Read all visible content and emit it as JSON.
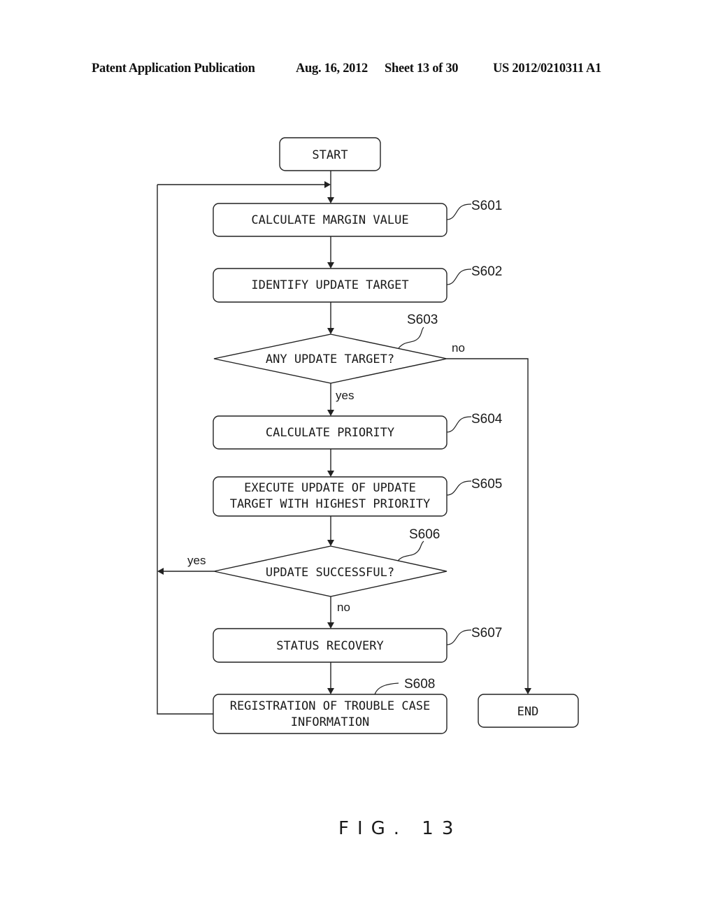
{
  "header": {
    "publication": "Patent Application Publication",
    "date": "Aug. 16, 2012",
    "sheet": "Sheet 13 of 30",
    "number": "US 2012/0210311 A1"
  },
  "flowchart": {
    "start": "START",
    "end": "END",
    "steps": [
      {
        "id": "S601",
        "type": "process",
        "lines": [
          "CALCULATE MARGIN VALUE"
        ]
      },
      {
        "id": "S602",
        "type": "process",
        "lines": [
          "IDENTIFY UPDATE TARGET"
        ]
      },
      {
        "id": "S603",
        "type": "decision",
        "lines": [
          "ANY UPDATE TARGET?"
        ],
        "yes": "S604",
        "no": "END"
      },
      {
        "id": "S604",
        "type": "process",
        "lines": [
          "CALCULATE PRIORITY"
        ]
      },
      {
        "id": "S605",
        "type": "process",
        "lines": [
          "EXECUTE UPDATE OF UPDATE",
          "TARGET WITH HIGHEST PRIORITY"
        ]
      },
      {
        "id": "S606",
        "type": "decision",
        "lines": [
          "UPDATE SUCCESSFUL?"
        ],
        "yes": "S601",
        "no": "S607"
      },
      {
        "id": "S607",
        "type": "process",
        "lines": [
          "STATUS RECOVERY"
        ]
      },
      {
        "id": "S608",
        "type": "process",
        "lines": [
          "REGISTRATION OF TROUBLE CASE",
          "INFORMATION"
        ]
      }
    ],
    "branch_labels": {
      "S603_no": "no",
      "S603_yes": "yes",
      "S606_yes": "yes",
      "S606_no": "no"
    }
  },
  "figure_caption": "FIG. 13"
}
